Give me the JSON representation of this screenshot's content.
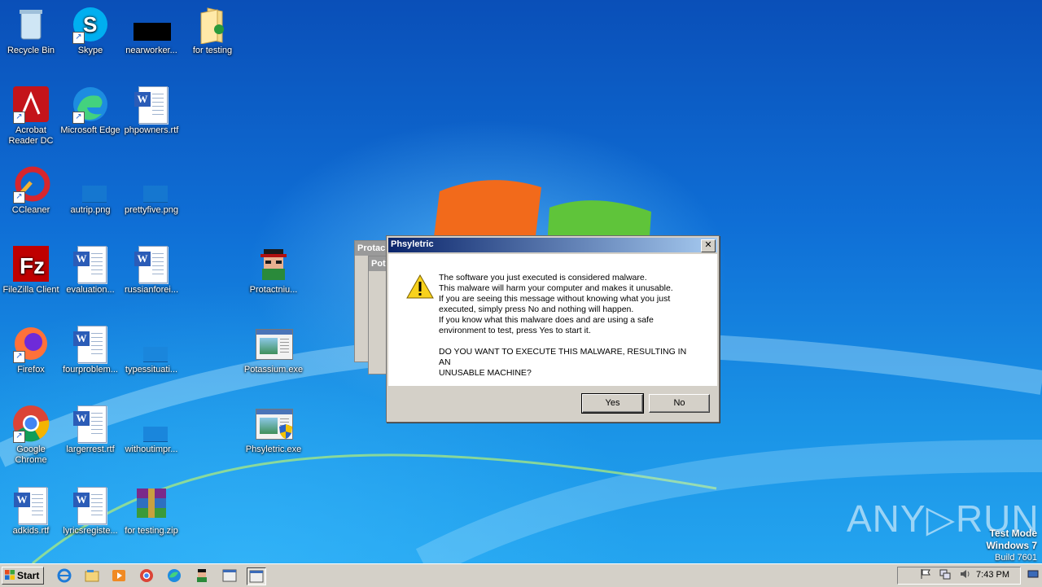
{
  "desktop": {
    "icons": [
      {
        "name": "recycle-bin-icon",
        "label": "Recycle Bin"
      },
      {
        "name": "skype-icon",
        "label": "Skype"
      },
      {
        "name": "nearworker-icon",
        "label": "nearworker..."
      },
      {
        "name": "folder-icon",
        "label": "for testing"
      },
      {
        "name": "acrobat-icon",
        "label": "Acrobat Reader DC"
      },
      {
        "name": "edge-icon",
        "label": "Microsoft Edge"
      },
      {
        "name": "word-doc-icon",
        "label": "phpowners.rtf"
      },
      {
        "name": "ccleaner-icon",
        "label": "CCleaner"
      },
      {
        "name": "png-icon",
        "label": "autrip.png"
      },
      {
        "name": "png-icon",
        "label": "prettyfive.png"
      },
      {
        "name": "filezilla-icon",
        "label": "FileZilla Client"
      },
      {
        "name": "word-doc-icon",
        "label": "evaluation..."
      },
      {
        "name": "word-doc-icon",
        "label": "russianforei..."
      },
      {
        "name": "malware-exe-icon",
        "label": "Protactniu..."
      },
      {
        "name": "firefox-icon",
        "label": "Firefox"
      },
      {
        "name": "word-doc-icon",
        "label": "fourproblem..."
      },
      {
        "name": "blank-file-icon",
        "label": "typessituati..."
      },
      {
        "name": "exe-icon",
        "label": "Potassium.exe"
      },
      {
        "name": "chrome-icon",
        "label": "Google Chrome"
      },
      {
        "name": "word-doc-icon",
        "label": "largerrest.rtf"
      },
      {
        "name": "blank-file-icon",
        "label": "withoutimpr..."
      },
      {
        "name": "exe-shield-icon",
        "label": "Phsyletric.exe"
      },
      {
        "name": "word-doc-icon",
        "label": "adkids.rtf"
      },
      {
        "name": "word-doc-icon",
        "label": "lyricsregiste..."
      },
      {
        "name": "winrar-icon",
        "label": "for testing.zip"
      }
    ]
  },
  "background_windows": [
    {
      "title": "Protac"
    },
    {
      "title": "Pot"
    }
  ],
  "dialog": {
    "title": "Phsyletric",
    "close": "✕",
    "lines": [
      "The software you just executed is considered malware.",
      "This malware will harm your computer and makes it unusable.",
      "If you are seeing this message without knowing what you just",
      "executed, simply press No and nothing will happen.",
      "If you know what this malware does and are using a safe",
      "environment to test, press Yes to start it."
    ],
    "question_lines": [
      "DO YOU WANT TO EXECUTE THIS MALWARE, RESULTING IN AN",
      "UNUSABLE MACHINE?"
    ],
    "yes_label": "Yes",
    "no_label": "No"
  },
  "watermark": {
    "text": "ANY▷RUN"
  },
  "test_mode": {
    "line1": "Test Mode",
    "line2": "Windows 7",
    "line3": "Build 7601"
  },
  "taskbar": {
    "start_label": "Start",
    "clock": "7:43 PM"
  },
  "colors": {
    "titlebar_start": "#0a246a",
    "titlebar_end": "#a6caf0",
    "desktop": "#0f6fd6"
  }
}
